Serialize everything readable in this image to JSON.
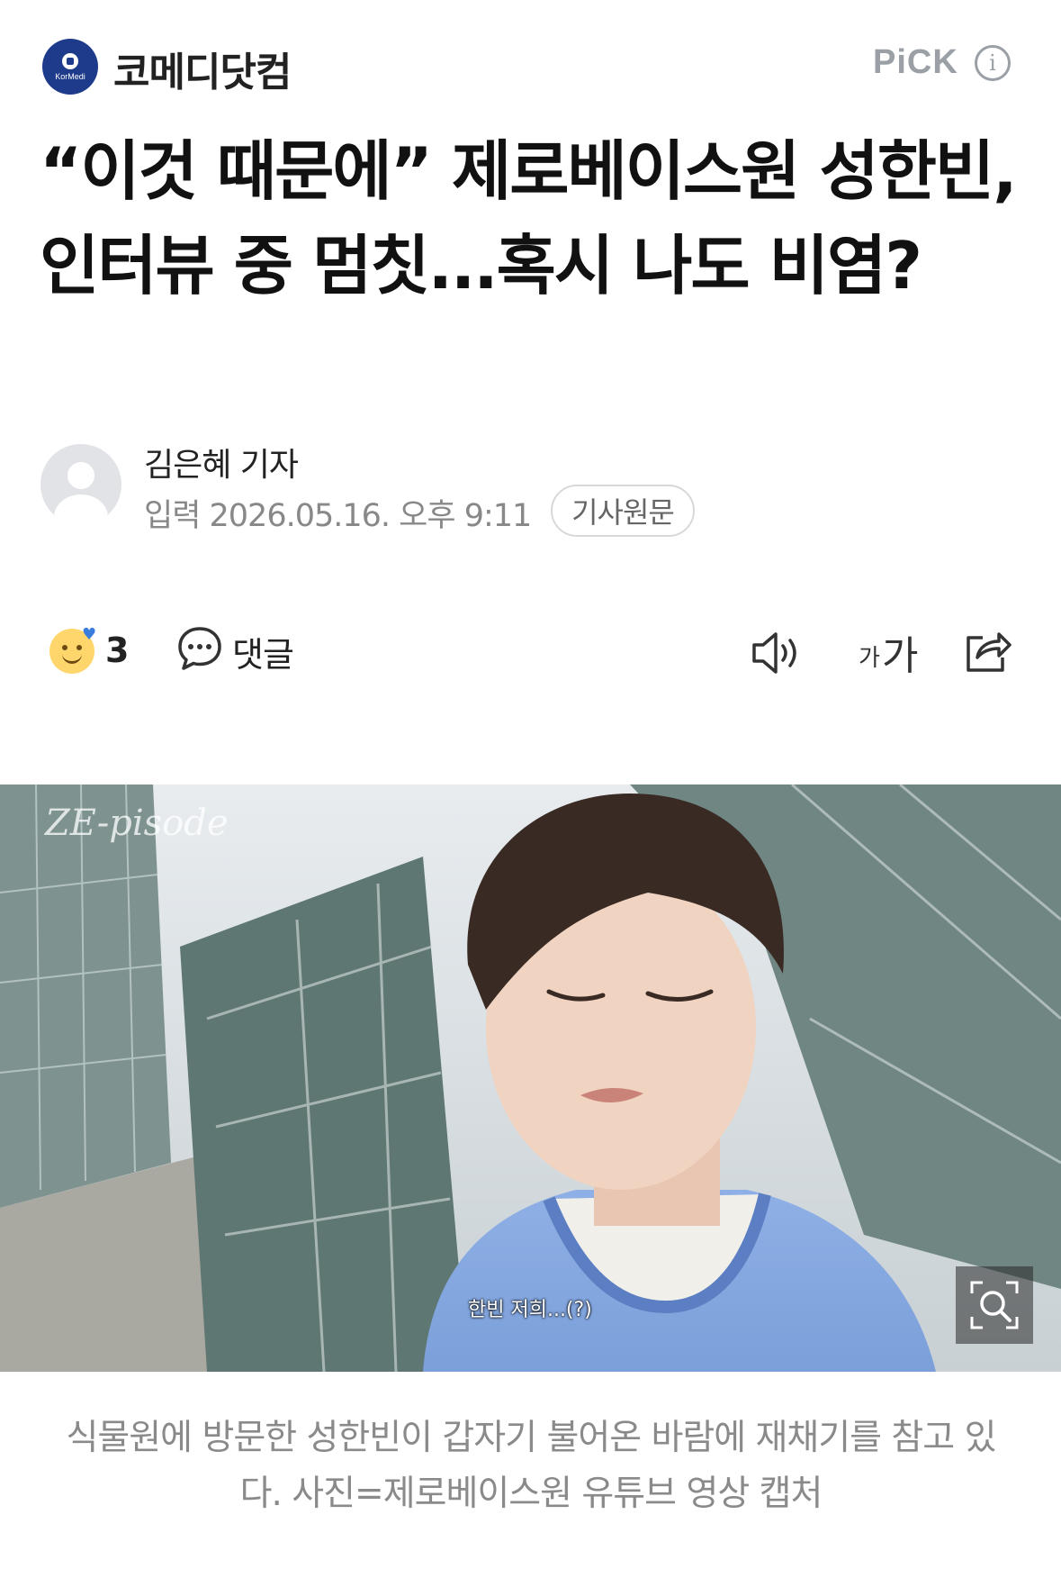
{
  "header": {
    "publisher_name": "코메디닷컴",
    "logo_text": "KorMedi",
    "pick_label": "PiCK",
    "info_icon": "info-circle-icon"
  },
  "article": {
    "title": "“이것 때문에” 제로베이스원 성한빈, 인터뷰 중 멈칫...혹시 나도 비염?",
    "reporter": "김은혜 기자",
    "published": "입력 2026.05.16. 오후 9:11",
    "original_button": "기사원문"
  },
  "actions": {
    "reaction_icon": "smile-emoji-icon",
    "reaction_count": "3",
    "comment_label": "댓글",
    "tts_icon": "speaker-icon",
    "font_size_small": "가",
    "font_size_big": "가",
    "share_icon": "share-icon"
  },
  "photo": {
    "watermark": "ZE-pisode",
    "subtitle": "한빈  저희...(?)",
    "zoom_icon": "zoom-search-icon"
  },
  "caption": "식물원에 방문한 성한빈이 갑자기 불어온 바람에 재채기를 참고 있다. 사진=제로베이스원 유튜브 영상 캡처"
}
